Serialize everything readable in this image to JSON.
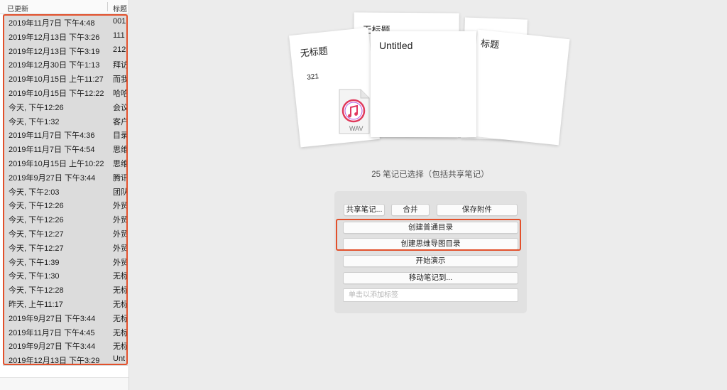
{
  "list": {
    "header_updated": "已更新",
    "header_title": "标题",
    "rows": [
      {
        "date": "2019年11月7日 下午4:48",
        "title": "001"
      },
      {
        "date": "2019年12月13日 下午3:26",
        "title": "111"
      },
      {
        "date": "2019年12月13日 下午3:19",
        "title": "212"
      },
      {
        "date": "2019年12月30日 下午1:13",
        "title": "拜访"
      },
      {
        "date": "2019年10月15日 上午11:27",
        "title": "而我"
      },
      {
        "date": "2019年10月15日 下午12:22",
        "title": "哈哈"
      },
      {
        "date": "今天, 下午12:26",
        "title": "会议"
      },
      {
        "date": "今天, 下午1:32",
        "title": "客户"
      },
      {
        "date": "2019年11月7日 下午4:36",
        "title": "目录"
      },
      {
        "date": "2019年11月7日 下午4:54",
        "title": "思维"
      },
      {
        "date": "2019年10月15日 上午10:22",
        "title": "思维"
      },
      {
        "date": "2019年9月27日 下午3:44",
        "title": "腾讯"
      },
      {
        "date": "今天, 下午2:03",
        "title": "团队"
      },
      {
        "date": "今天, 下午12:26",
        "title": "外贸"
      },
      {
        "date": "今天, 下午12:26",
        "title": "外贸"
      },
      {
        "date": "今天, 下午12:27",
        "title": "外贸"
      },
      {
        "date": "今天, 下午12:27",
        "title": "外贸"
      },
      {
        "date": "今天, 下午1:39",
        "title": "外贸"
      },
      {
        "date": "今天, 下午1:30",
        "title": "无标"
      },
      {
        "date": "今天, 下午12:28",
        "title": "无标"
      },
      {
        "date": "昨天, 上午11:17",
        "title": "无标"
      },
      {
        "date": "2019年9月27日 下午3:44",
        "title": "无标"
      },
      {
        "date": "2019年11月7日 下午4:45",
        "title": "无标"
      },
      {
        "date": "2019年9月27日 下午3:44",
        "title": "无标"
      },
      {
        "date": "2019年12月13日 下午3:29",
        "title": "Unt"
      }
    ]
  },
  "cards": {
    "back1_title": "无标题",
    "left_title": "无标题",
    "left_body": "321",
    "right_title": "标题",
    "front_title": "Untitled",
    "attachment_label": "WAV",
    "attachment_icon": "itunes-music-file-icon"
  },
  "selection": {
    "summary": "25 笔记已选择（包括共享笔记）"
  },
  "actions": {
    "share": "共享笔记...",
    "merge": "合并",
    "save_attachments": "保存附件",
    "create_toc": "创建普通目录",
    "create_mindmap_toc": "创建思维导图目录",
    "present": "开始演示",
    "move": "移动笔记到...",
    "tag_placeholder": "单击以添加标签"
  },
  "colors": {
    "highlight": "#e2502b",
    "selected_row": "#dcdcdc"
  }
}
